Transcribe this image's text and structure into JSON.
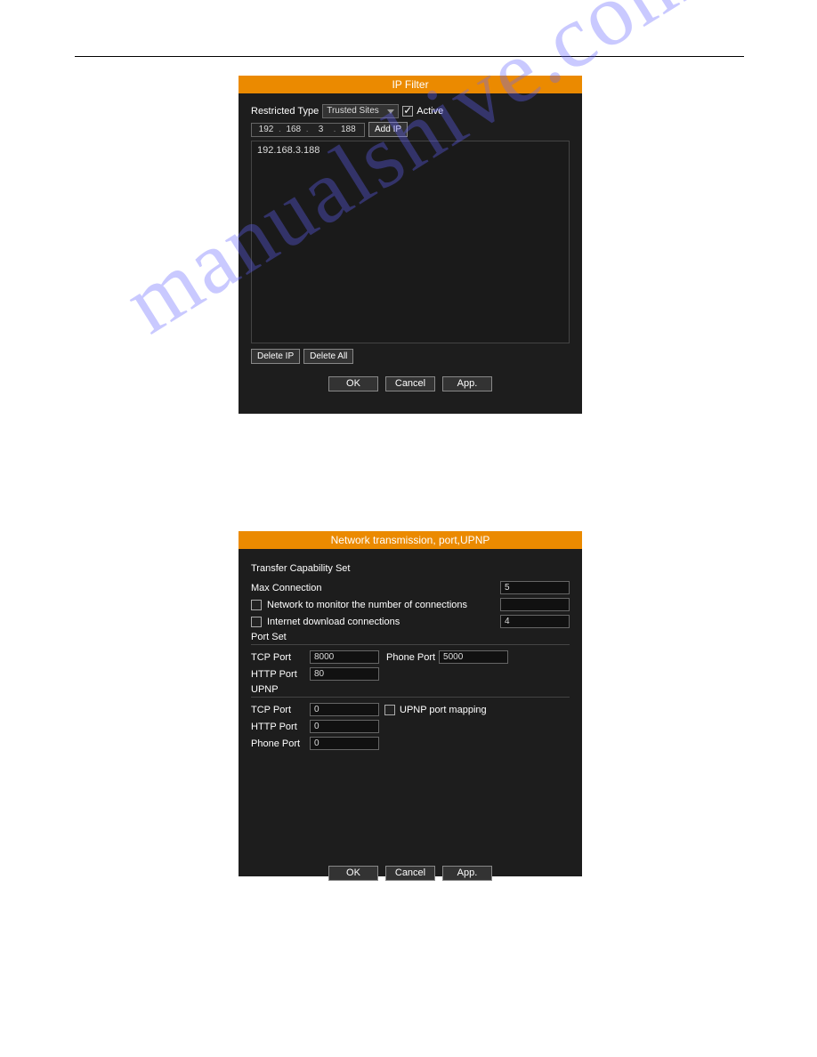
{
  "watermark_text": "manualshive.com",
  "ip_filter": {
    "title": "IP Filter",
    "restricted_type_label": "Restricted Type",
    "restricted_type_value": "Trusted Sites",
    "active_label": "Active",
    "active_checked": true,
    "ip_octets": [
      "192",
      "168",
      "3",
      "188"
    ],
    "add_ip_label": "Add IP",
    "ip_list": [
      "192.168.3.188"
    ],
    "delete_ip_label": "Delete IP",
    "delete_all_label": "Delete All",
    "ok_label": "OK",
    "cancel_label": "Cancel",
    "app_label": "App."
  },
  "network": {
    "title": "Network transmission, port,UPNP",
    "transfer_section_title": "Transfer Capability Set",
    "max_connection_label": "Max Connection",
    "max_connection_value": "5",
    "monitor_label": "Network to monitor the number of connections",
    "monitor_checked": false,
    "monitor_value": "",
    "download_label": "Internet download connections",
    "download_checked": false,
    "download_value": "4",
    "port_set_title": "Port Set",
    "tcp_port_label": "TCP Port",
    "tcp_port_value": "8000",
    "phone_port_label": "Phone Port",
    "phone_port_value": "5000",
    "http_port_label": "HTTP Port",
    "http_port_value": "80",
    "upnp_title": "UPNP",
    "upnp_tcp_label": "TCP Port",
    "upnp_tcp_value": "0",
    "upnp_mapping_label": "UPNP port mapping",
    "upnp_mapping_checked": false,
    "upnp_http_label": "HTTP Port",
    "upnp_http_value": "0",
    "upnp_phone_label": "Phone Port",
    "upnp_phone_value": "0",
    "ok_label": "OK",
    "cancel_label": "Cancel",
    "app_label": "App."
  }
}
